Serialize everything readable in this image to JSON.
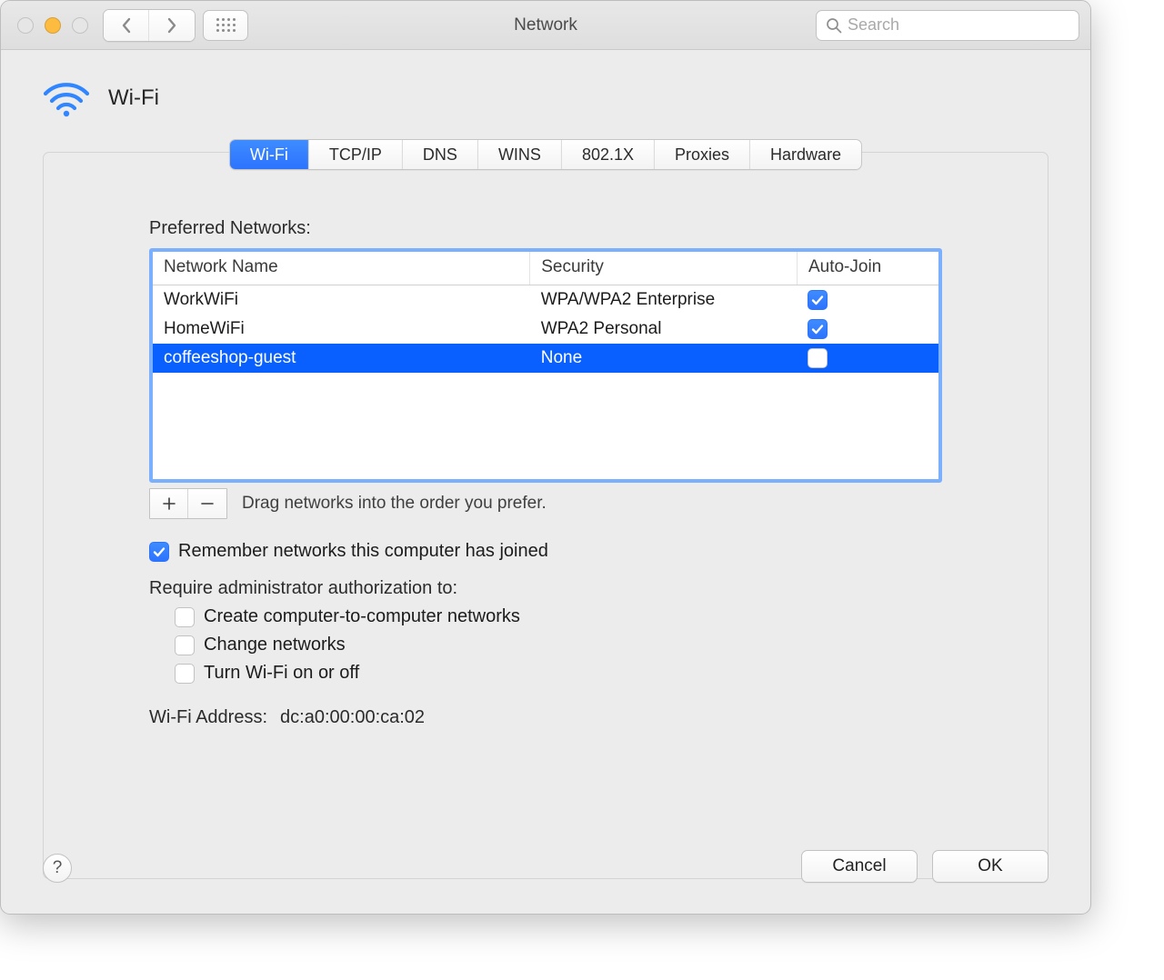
{
  "window": {
    "title": "Network"
  },
  "search": {
    "placeholder": "Search"
  },
  "header": {
    "title": "Wi-Fi"
  },
  "tabs": {
    "items": [
      "Wi-Fi",
      "TCP/IP",
      "DNS",
      "WINS",
      "802.1X",
      "Proxies",
      "Hardware"
    ],
    "active_index": 0
  },
  "section": {
    "preferred_label": "Preferred Networks:",
    "columns": {
      "name": "Network Name",
      "security": "Security",
      "autojoin": "Auto-Join"
    },
    "rows": [
      {
        "name": "WorkWiFi",
        "security": "WPA/WPA2 Enterprise",
        "autojoin": true,
        "selected": false
      },
      {
        "name": "HomeWiFi",
        "security": "WPA2 Personal",
        "autojoin": true,
        "selected": false
      },
      {
        "name": "coffeeshop-guest",
        "security": "None",
        "autojoin": false,
        "selected": true
      }
    ],
    "drag_hint": "Drag networks into the order you prefer."
  },
  "options": {
    "remember": {
      "label": "Remember networks this computer has joined",
      "checked": true
    },
    "admin_heading": "Require administrator authorization to:",
    "admin": {
      "create": {
        "label": "Create computer-to-computer networks",
        "checked": false
      },
      "change": {
        "label": "Change networks",
        "checked": false
      },
      "turn": {
        "label": "Turn Wi-Fi on or off",
        "checked": false
      }
    }
  },
  "wifi_address": {
    "label": "Wi-Fi Address:",
    "value": "dc:a0:00:00:ca:02"
  },
  "footer": {
    "cancel": "Cancel",
    "ok": "OK"
  }
}
